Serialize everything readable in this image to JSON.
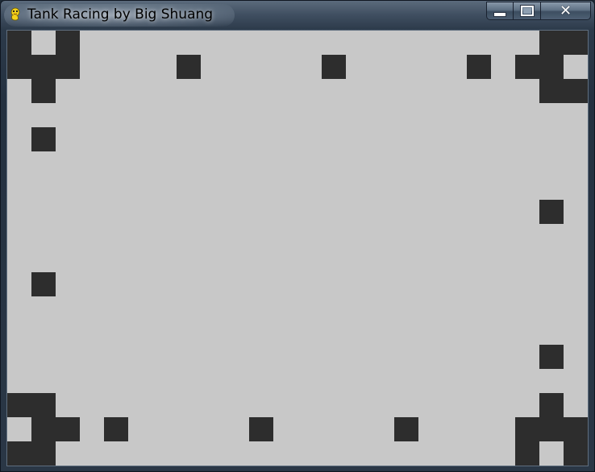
{
  "window": {
    "title": "Tank Racing by Big Shuang",
    "icon": "pygame-snake-icon",
    "controls": {
      "minimize_icon": "minimize-icon",
      "maximize_icon": "maximize-icon",
      "close_icon": "close-icon",
      "close_glyph": "✕"
    }
  },
  "game": {
    "grid": {
      "columns": 24,
      "rows": 18,
      "cell_unit": 30
    },
    "colors": {
      "background": "#c8c8c8",
      "wall": "#2d2d2d"
    },
    "walls": [
      [
        0,
        0
      ],
      [
        2,
        0
      ],
      [
        22,
        0
      ],
      [
        23,
        0
      ],
      [
        0,
        1
      ],
      [
        1,
        1
      ],
      [
        2,
        1
      ],
      [
        7,
        1
      ],
      [
        13,
        1
      ],
      [
        19,
        1
      ],
      [
        21,
        1
      ],
      [
        22,
        1
      ],
      [
        1,
        2
      ],
      [
        22,
        2
      ],
      [
        23,
        2
      ],
      [
        1,
        4
      ],
      [
        22,
        7
      ],
      [
        1,
        10
      ],
      [
        22,
        13
      ],
      [
        0,
        15
      ],
      [
        1,
        15
      ],
      [
        22,
        15
      ],
      [
        1,
        16
      ],
      [
        2,
        16
      ],
      [
        4,
        16
      ],
      [
        10,
        16
      ],
      [
        16,
        16
      ],
      [
        21,
        16
      ],
      [
        22,
        16
      ],
      [
        23,
        16
      ],
      [
        0,
        17
      ],
      [
        1,
        17
      ],
      [
        21,
        17
      ],
      [
        23,
        17
      ]
    ]
  }
}
